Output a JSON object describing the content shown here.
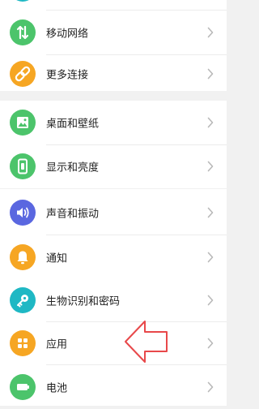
{
  "colors": {
    "green": "#4cc46b",
    "orange": "#f6a623",
    "blue": "#5a67e0",
    "teal": "#1fb8c4",
    "arrow": "#e8484a",
    "chevron": "#b9b9b9"
  },
  "groups": [
    {
      "items": [
        {
          "label": "移动网络",
          "icon": "mobile-data-icon"
        },
        {
          "label": "更多连接",
          "icon": "link-icon"
        }
      ]
    },
    {
      "items": [
        {
          "label": "桌面和壁纸",
          "icon": "wallpaper-icon"
        },
        {
          "label": "显示和亮度",
          "icon": "display-brightness-icon"
        }
      ]
    },
    {
      "items": [
        {
          "label": "声音和振动",
          "icon": "volume-icon"
        },
        {
          "label": "通知",
          "icon": "bell-icon"
        }
      ]
    },
    {
      "items": [
        {
          "label": "生物识别和密码",
          "icon": "key-icon"
        },
        {
          "label": "应用",
          "icon": "apps-grid-icon"
        },
        {
          "label": "电池",
          "icon": "battery-icon"
        }
      ]
    }
  ]
}
